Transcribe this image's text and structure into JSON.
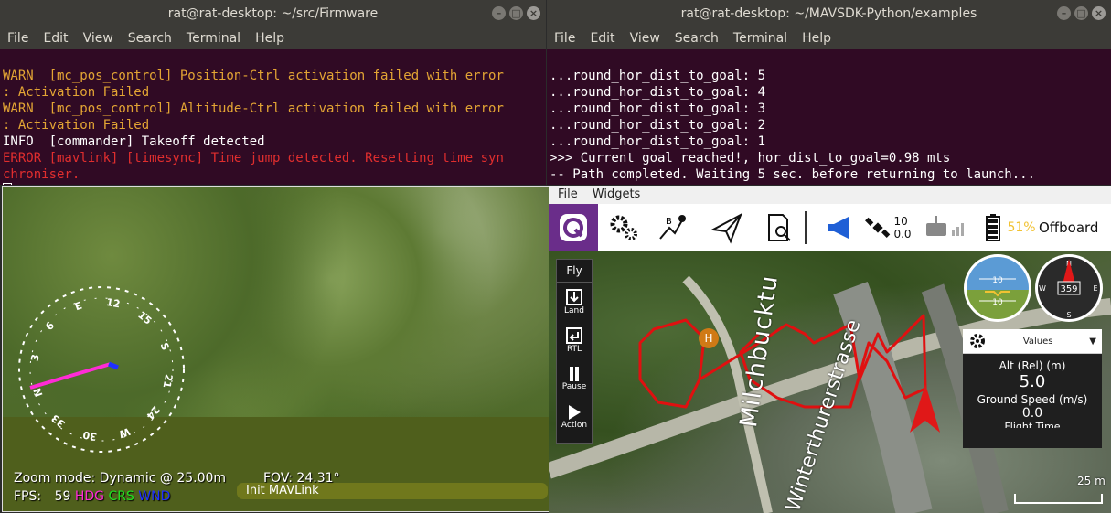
{
  "terminal_left": {
    "title": "rat@rat-desktop: ~/src/Firmware",
    "menu": [
      "File",
      "Edit",
      "View",
      "Search",
      "Terminal",
      "Help"
    ],
    "lines": [
      {
        "cls": "warn",
        "text": "WARN  [mc_pos_control] Position-Ctrl activation failed with error"
      },
      {
        "cls": "warn",
        "text": ": Activation Failed"
      },
      {
        "cls": "warn",
        "text": "WARN  [mc_pos_control] Altitude-Ctrl activation failed with error"
      },
      {
        "cls": "warn",
        "text": ": Activation Failed"
      },
      {
        "cls": "",
        "text": "INFO  [commander] Takeoff detected"
      },
      {
        "cls": "err",
        "text": "ERROR [mavlink] [timesync] Time jump detected. Resetting time syn"
      },
      {
        "cls": "err",
        "text": "chroniser."
      }
    ]
  },
  "terminal_right": {
    "title": "rat@rat-desktop: ~/MAVSDK-Python/examples",
    "menu": [
      "File",
      "Edit",
      "View",
      "Search",
      "Terminal",
      "Help"
    ],
    "lines": [
      "...round_hor_dist_to_goal: 5",
      "...round_hor_dist_to_goal: 4",
      "...round_hor_dist_to_goal: 3",
      "...round_hor_dist_to_goal: 2",
      "...round_hor_dist_to_goal: 1",
      ">>> Current goal reached!, hor_dist_to_goal=0.98 mts",
      "-- Path completed. Waiting 5 sec. before returning to launch..."
    ]
  },
  "gazebo": {
    "zoom_label": "Zoom mode: Dynamic @ 25.00m",
    "fov_label": "FOV: 24.31°",
    "fps_label": "FPS:",
    "fps_value": "59",
    "legend_hdg": "HDG",
    "legend_crs": "CRS",
    "legend_wnd": "WND",
    "status": "Init MAVLink",
    "compass_labels": [
      "E",
      "12",
      "15",
      "S",
      "21",
      "24",
      "W",
      "30",
      "33",
      "N",
      "3",
      "6"
    ]
  },
  "qgc": {
    "menu": [
      "File",
      "Widgets"
    ],
    "sat_count": "10",
    "hdop": "0.0",
    "battery": "51%",
    "flight_mode": "Offboard",
    "fly_title": "Fly",
    "fly_tools": [
      "Land",
      "RTL",
      "Pause",
      "Action"
    ],
    "home_marker": "H",
    "map_street_1": "Milchbucktu",
    "map_street_2": "Winterthurerstrasse",
    "scale": "25 m",
    "attitude_top": "10",
    "attitude_bottom": "10",
    "heading": "359",
    "compass": {
      "n": "N",
      "s": "S",
      "e": "E",
      "w": "W"
    },
    "values_title": "Values",
    "alt_label": "Alt (Rel) (m)",
    "alt_value": "5.0",
    "gs_label": "Ground Speed (m/s)",
    "gs_value": "0.0",
    "extra_label": "Flight Time"
  },
  "colors": {
    "terminal_bg": "#300a24",
    "warn": "#e3a534",
    "error": "#e02e2e",
    "accent": "#6a2d8a",
    "battery": "#f1c232",
    "track": "#e01010"
  }
}
